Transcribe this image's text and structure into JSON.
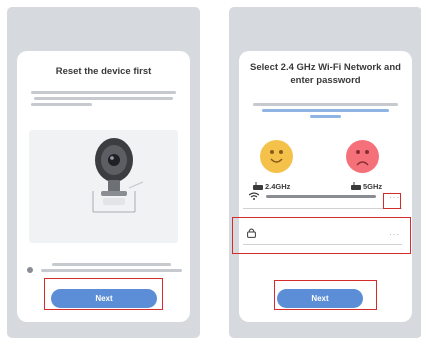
{
  "screens": [
    {
      "title": "Reset the device first",
      "next_label": "Next"
    },
    {
      "title": "Select 2.4 GHz Wi-Fi Network and enter password",
      "band_2g": "2.4GHz",
      "band_5g": "5GHz",
      "next_label": "Next"
    }
  ],
  "colors": {
    "accent": "#5b8ed6",
    "highlight": "#d62b2b",
    "background": "#d6d9de",
    "card": "#ffffff"
  },
  "icons": [
    "camera-illustration",
    "happy-face-icon",
    "sad-face-icon",
    "router-icon",
    "wifi-icon",
    "lock-icon",
    "more-icon"
  ]
}
